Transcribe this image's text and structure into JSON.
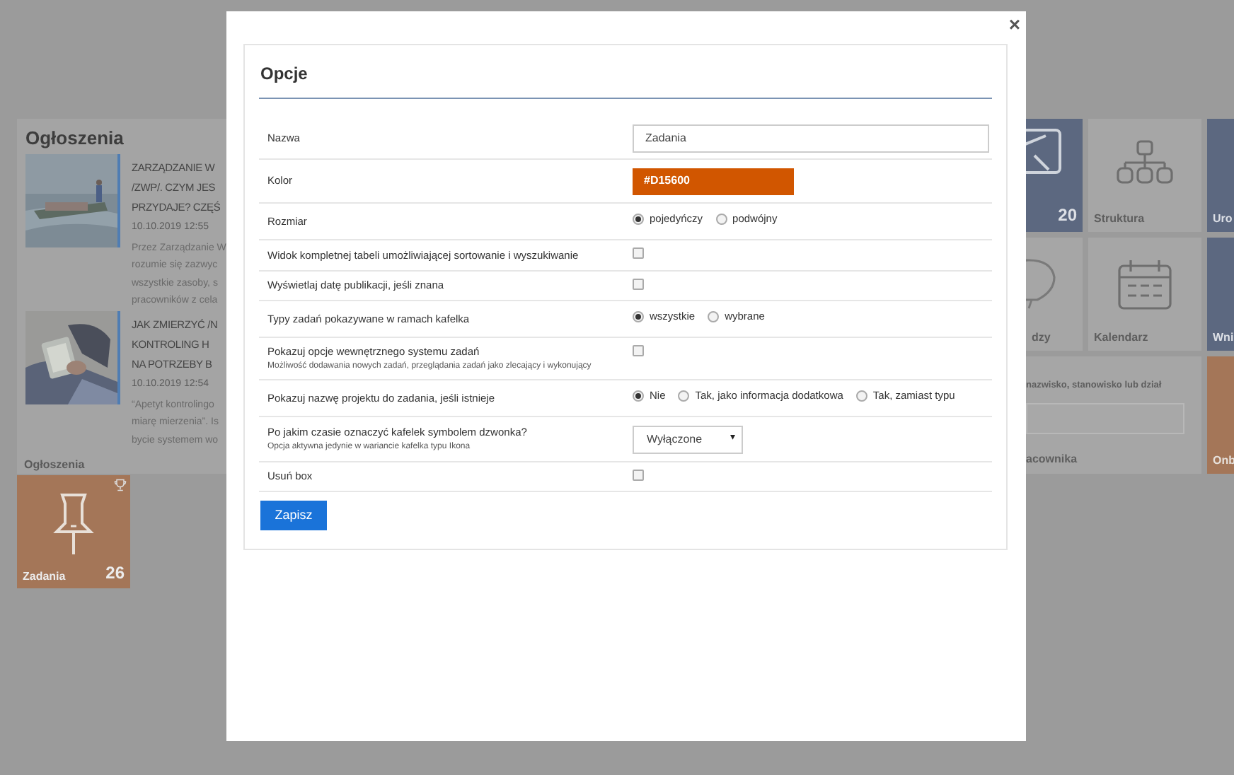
{
  "announcements": {
    "heading": "Ogłoszenia",
    "items": [
      {
        "title_lines": [
          "ZARZĄDZANIE W",
          "/ZWP/. CZYM JES",
          "PRZYDAJE? CZĘŚ"
        ],
        "date": "10.10.2019 12:55",
        "excerpt_lines": [
          "Przez Zarządzanie W",
          "rozumie się zazwyc",
          "wszystkie zasoby, s",
          "pracowników z cela"
        ]
      },
      {
        "title_lines": [
          "JAK ZMIERZYĆ /N",
          "KONTROLING H",
          "NA POTRZEBY B"
        ],
        "date": "10.10.2019 12:54",
        "excerpt_lines": [
          "“Apetyt kontrolingo",
          "miarę mierzenia”. Is",
          "bycie systemem wo"
        ]
      }
    ],
    "footer": "Ogłoszenia"
  },
  "task_tile": {
    "label": "Zadania",
    "count": "26"
  },
  "tiles": [
    {
      "kind": "blue",
      "count": "20"
    },
    {
      "kind": "gray",
      "label": "Struktura"
    },
    {
      "kind": "blue",
      "label": "Uro"
    },
    {
      "kind": "gray",
      "label": "dzy"
    },
    {
      "kind": "gray",
      "label": "Kalendarz"
    },
    {
      "kind": "blue",
      "label": "Wni"
    }
  ],
  "employee_search": {
    "hint": "nazwisko, stanowisko lub dział",
    "footer": "acownika"
  },
  "orange_tile": {
    "label": "Onb"
  },
  "modal": {
    "close": "×",
    "title": "Opcje",
    "fields": [
      {
        "kind": "text",
        "label": "Nazwa",
        "value": "Zadania"
      },
      {
        "kind": "color",
        "label": "Kolor",
        "value": "#D15600",
        "color": "#d15600"
      },
      {
        "kind": "radio",
        "label": "Rozmiar",
        "options": [
          {
            "label": "pojedyńczy",
            "selected": true
          },
          {
            "label": "podwójny",
            "selected": false
          }
        ]
      },
      {
        "kind": "checkbox",
        "label": "Widok kompletnej tabeli umożliwiającej sortowanie i wyszukiwanie",
        "checked": false
      },
      {
        "kind": "checkbox",
        "label": "Wyświetlaj datę publikacji, jeśli znana",
        "checked": false
      },
      {
        "kind": "radio",
        "label": "Typy zadań pokazywane w ramach kafelka",
        "options": [
          {
            "label": "wszystkie",
            "selected": true
          },
          {
            "label": "wybrane",
            "selected": false
          }
        ]
      },
      {
        "kind": "checkbox",
        "label": "Pokazuj opcje wewnętrznego systemu zadań",
        "hint": "Możliwość dodawania nowych zadań, przeglądania zadań jako zlecający i wykonujący",
        "checked": false
      },
      {
        "kind": "radio",
        "label": "Pokazuj nazwę projektu do zadania, jeśli istnieje",
        "options": [
          {
            "label": "Nie",
            "selected": true
          },
          {
            "label": "Tak, jako informacja dodatkowa",
            "selected": false
          },
          {
            "label": "Tak, zamiast typu",
            "selected": false
          }
        ]
      },
      {
        "kind": "select",
        "label": "Po jakim czasie oznaczyć kafelek symbolem dzwonka?",
        "hint": "Opcja aktywna jedynie w wariancie kafelka typu Ikona",
        "value": "Wyłączone",
        "caret": "▾"
      },
      {
        "kind": "checkbox",
        "label": "Usuń box",
        "checked": false
      }
    ],
    "save": "Zapisz"
  }
}
